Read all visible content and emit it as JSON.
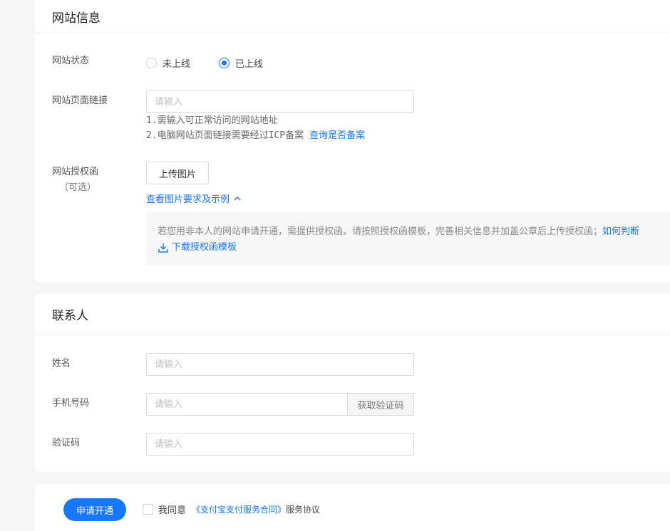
{
  "website_section": {
    "title": "网站信息",
    "status_label": "网站状态",
    "status_options": [
      "未上线",
      "已上线"
    ],
    "status_selected": "已上线",
    "link_label": "网站页面链接",
    "link_placeholder": "请输入",
    "hint_line1": "1.需输入可正常访问的网站地址",
    "hint_line2": "2.电脑网站页面链接需要经过ICP备案",
    "hint_link": "查询是否备案",
    "auth_label": "网站授权函",
    "auth_optional": "（可选）",
    "upload_button": "上传图片",
    "view_example_link": "查看图片要求及示例",
    "notice_text": "若您用非本人的网站申请开通，需提供授权函。请按照授权函模板，完善相关信息并加盖公章后上传授权函；",
    "notice_link": "如何判断",
    "download_link": "下载授权函模板"
  },
  "contact_section": {
    "title": "联系人",
    "name_label": "姓名",
    "name_placeholder": "请输入",
    "phone_label": "手机号码",
    "phone_placeholder": "请输入",
    "get_code_button": "获取验证码",
    "code_label": "验证码",
    "code_placeholder": "请输入"
  },
  "footer": {
    "submit_button": "申请开通",
    "agree_text": "我同意",
    "contract_link": "《支付宝支付服务合同》",
    "agreement_suffix": "服务协议"
  },
  "colors": {
    "primary": "#1677ff",
    "background": "#f5f5f5"
  }
}
